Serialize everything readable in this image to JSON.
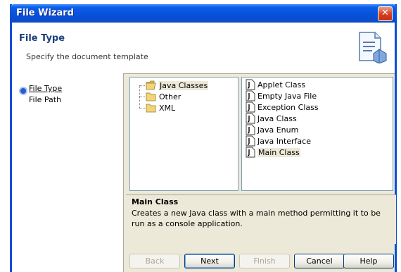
{
  "window": {
    "title": "File Wizard",
    "close_glyph": "✕"
  },
  "header": {
    "title": "File Type",
    "subtitle": "Specify the document template",
    "icon": "document-template-icon"
  },
  "steps": [
    {
      "label": "File Type",
      "active": true
    },
    {
      "label": "File Path",
      "active": false
    }
  ],
  "categories": [
    {
      "label": "Java Classes",
      "icon": "folder-open-icon",
      "selected": true
    },
    {
      "label": "Other",
      "icon": "folder-icon",
      "selected": false
    },
    {
      "label": "XML",
      "icon": "folder-icon",
      "selected": false
    }
  ],
  "templates": [
    {
      "label": "Applet Class",
      "selected": false
    },
    {
      "label": "Empty Java File",
      "selected": false
    },
    {
      "label": "Exception Class",
      "selected": false
    },
    {
      "label": "Java Class",
      "selected": false
    },
    {
      "label": "Java Enum",
      "selected": false
    },
    {
      "label": "Java Interface",
      "selected": false
    },
    {
      "label": "Main Class",
      "selected": true
    }
  ],
  "description": {
    "title": "Main Class",
    "text": "Creates a new Java class with a main method permitting it to be run as a console application."
  },
  "buttons": {
    "back": "Back",
    "next": "Next",
    "finish": "Finish",
    "cancel": "Cancel",
    "help": "Help"
  },
  "colors": {
    "title_bar": "#0a4fd8",
    "dialog_face": "#ece9d8",
    "accent": "#1c3f7e"
  }
}
